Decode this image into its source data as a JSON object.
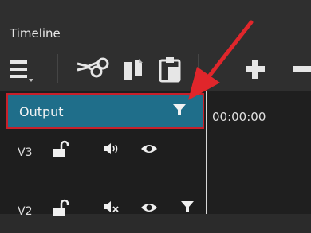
{
  "panel": {
    "title": "Timeline"
  },
  "toolbar": {
    "buttons": [
      {
        "icon": "hamburger-menu-icon"
      },
      {
        "icon": "scissors-icon"
      },
      {
        "icon": "copy-icon"
      },
      {
        "icon": "paste-icon"
      },
      {
        "icon": "plus-icon"
      },
      {
        "icon": "minus-icon"
      }
    ]
  },
  "output_track": {
    "label": "Output",
    "icon": "filter-icon"
  },
  "tracks": [
    {
      "name": "V3",
      "icons": [
        "unlock-icon",
        "speaker-icon",
        "eye-icon"
      ]
    },
    {
      "name": "V2",
      "icons": [
        "unlock-icon",
        "mute-icon",
        "eye-icon",
        "filter-icon"
      ]
    }
  ],
  "timeline": {
    "timecode": "00:00:00"
  },
  "annotation": {
    "color": "#e0262b"
  },
  "colors": {
    "output_bg": "#1f6e8a",
    "highlight_border": "#c8202a"
  }
}
